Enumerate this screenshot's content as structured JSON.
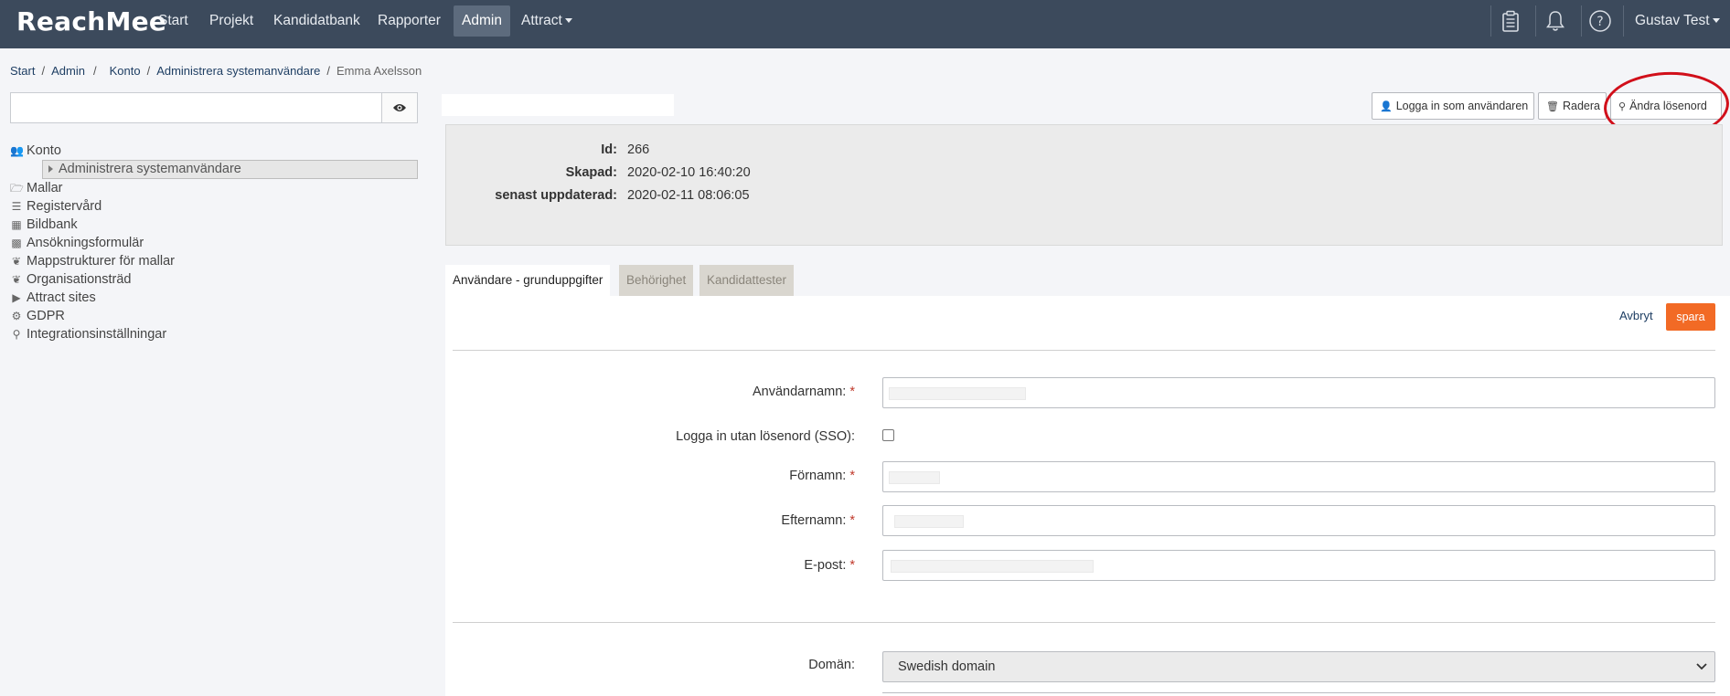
{
  "nav": {
    "logo": "ReachMee",
    "items": [
      "Start",
      "Projekt",
      "Kandidatbank",
      "Rapporter",
      "Admin",
      "Attract"
    ],
    "user": "Gustav Test",
    "icons": [
      "clipboard-icon",
      "bell-icon",
      "help-icon"
    ]
  },
  "breadcrumb": {
    "items": [
      "Start",
      "Admin",
      "Konto",
      "Administrera systemanvändare"
    ],
    "current": "Emma Axelsson"
  },
  "search": {
    "value": "",
    "placeholder": ""
  },
  "tree": {
    "root": "Konto",
    "selected": "Administrera systemanvändare",
    "items": [
      "Mallar",
      "Registervård",
      "Bildbank",
      "Ansökningsformulär",
      "Mappstrukturer för mallar",
      "Organisationsträd",
      "Attract sites",
      "GDPR",
      "Integrationsinställningar"
    ]
  },
  "actions": {
    "login_as": "Logga in som användaren",
    "delete": "Radera",
    "change_password": "Ändra lösenord"
  },
  "info": {
    "id_label": "Id:",
    "id_value": "266",
    "created_label": "Skapad:",
    "created_value": "2020-02-10 16:40:20",
    "updated_label": "senast uppdaterad:",
    "updated_value": "2020-02-11 08:06:05"
  },
  "tabs": [
    "Användare - grunduppgifter",
    "Behörighet",
    "Kandidattester"
  ],
  "form": {
    "cancel": "Avbryt",
    "save": "spara",
    "username_label": "Användarnamn:",
    "sso_label": "Logga in utan lösenord (SSO):",
    "firstname_label": "Förnamn:",
    "lastname_label": "Efternamn:",
    "email_label": "E-post:",
    "required_mark": "*",
    "domain_label": "Domän:",
    "domain_value": "Swedish domain"
  },
  "colors": {
    "topbar": "#3c4a5c",
    "accent": "#f26a25",
    "annotation_circle": "#d10f1a"
  }
}
